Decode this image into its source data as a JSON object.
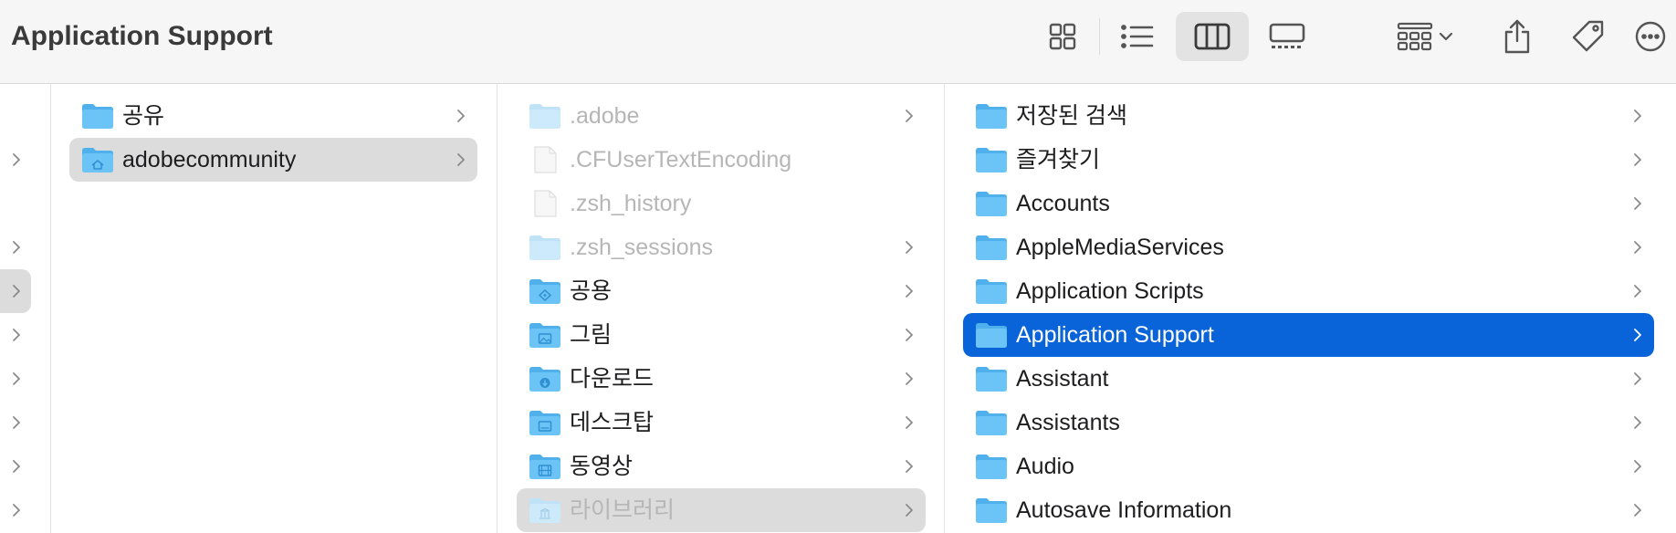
{
  "window": {
    "title": "Application Support"
  },
  "toolbar": {
    "buttons": [
      {
        "name": "view-icons-button",
        "icon": "grid-icon"
      },
      {
        "name": "view-list-button",
        "icon": "list-icon"
      },
      {
        "name": "view-columns-button",
        "icon": "columns-icon",
        "active": true
      },
      {
        "name": "view-gallery-button",
        "icon": "gallery-icon"
      },
      {
        "name": "group-button",
        "icon": "group-icon"
      },
      {
        "name": "share-button",
        "icon": "share-icon"
      },
      {
        "name": "tags-button",
        "icon": "tag-icon"
      },
      {
        "name": "more-button",
        "icon": "ellipsis-icon"
      }
    ]
  },
  "colors": {
    "selection_blue": "#0a64d9",
    "selection_gray": "#dcdcdc",
    "folder": "#5bb8f0"
  },
  "column1": {
    "items": [
      {
        "label": "공유",
        "icon": "folder-icon",
        "chevron": true
      },
      {
        "label": "adobecommunity",
        "icon": "home-folder-icon",
        "chevron": true,
        "selected": true
      }
    ]
  },
  "column2": {
    "items": [
      {
        "label": ".adobe",
        "icon": "folder-icon",
        "chevron": true,
        "dimmed": true
      },
      {
        "label": ".CFUserTextEncoding",
        "icon": "file-icon",
        "chevron": false,
        "dimmed": true
      },
      {
        "label": ".zsh_history",
        "icon": "file-icon",
        "chevron": false,
        "dimmed": true
      },
      {
        "label": ".zsh_sessions",
        "icon": "folder-icon",
        "chevron": true,
        "dimmed": true
      },
      {
        "label": "공용",
        "icon": "public-folder-icon",
        "chevron": true
      },
      {
        "label": "그림",
        "icon": "pictures-folder-icon",
        "chevron": true
      },
      {
        "label": "다운로드",
        "icon": "downloads-folder-icon",
        "chevron": true
      },
      {
        "label": "데스크탑",
        "icon": "desktop-folder-icon",
        "chevron": true
      },
      {
        "label": "동영상",
        "icon": "movies-folder-icon",
        "chevron": true
      },
      {
        "label": "라이브러리",
        "icon": "library-folder-icon",
        "chevron": true,
        "dimmed": true,
        "selected": true
      }
    ]
  },
  "column3": {
    "items": [
      {
        "label": "저장된 검색",
        "icon": "folder-icon",
        "chevron": true
      },
      {
        "label": "즐겨찾기",
        "icon": "folder-icon",
        "chevron": true
      },
      {
        "label": "Accounts",
        "icon": "folder-icon",
        "chevron": true
      },
      {
        "label": "AppleMediaServices",
        "icon": "folder-icon",
        "chevron": true
      },
      {
        "label": "Application Scripts",
        "icon": "folder-icon",
        "chevron": true
      },
      {
        "label": "Application Support",
        "icon": "folder-icon",
        "chevron": true,
        "selected": true
      },
      {
        "label": "Assistant",
        "icon": "folder-icon",
        "chevron": true
      },
      {
        "label": "Assistants",
        "icon": "folder-icon",
        "chevron": true
      },
      {
        "label": "Audio",
        "icon": "folder-icon",
        "chevron": true
      },
      {
        "label": "Autosave Information",
        "icon": "folder-icon",
        "chevron": true
      }
    ]
  },
  "column0": {
    "rows": [
      {
        "chevron": true
      },
      {
        "chevron": false
      },
      {
        "chevron": true
      },
      {
        "chevron": true,
        "selected": true
      },
      {
        "chevron": true
      },
      {
        "chevron": true
      },
      {
        "chevron": true
      },
      {
        "chevron": true
      },
      {
        "chevron": true
      }
    ]
  }
}
